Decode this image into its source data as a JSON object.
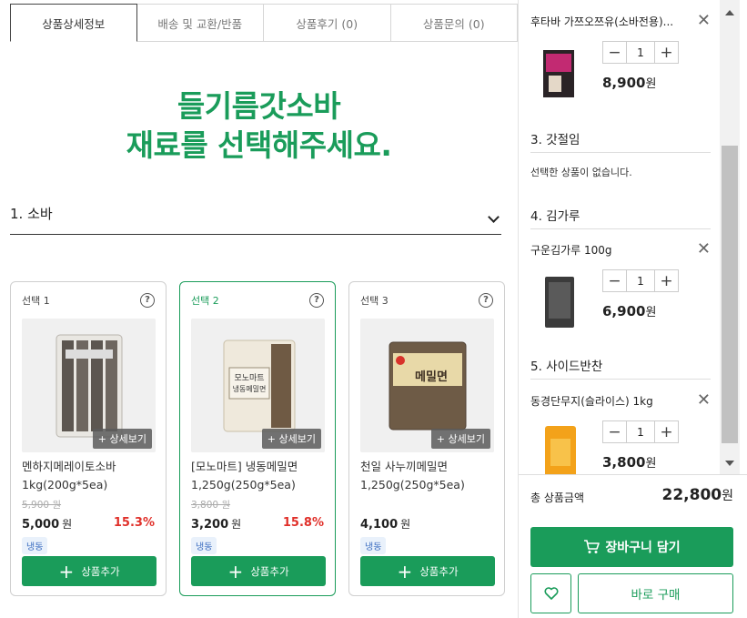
{
  "tabs": [
    {
      "label": "상품상세정보"
    },
    {
      "label": "배송 및 교환/반품"
    },
    {
      "label": "상품후기 (0)"
    },
    {
      "label": "상품문의 (0)"
    }
  ],
  "headline": {
    "line1": "들기름갓소바",
    "line2": "재료를 선택해주세요."
  },
  "section": {
    "label": "1. 소바"
  },
  "products": [
    {
      "option": "선택 1",
      "detail": "+ 상세보기",
      "name": "멘하지메레이토소바 1kg(200g*5ea)",
      "orig_price": "5,900 원",
      "price": "5,000",
      "won": "원",
      "discount": "15.3%",
      "tag": "냉동",
      "add": "상품추가"
    },
    {
      "option": "선택 2",
      "detail": "+ 상세보기",
      "name": "[모노마트] 냉동메밀면 1,250g(250g*5ea)",
      "orig_price": "3,800 원",
      "price": "3,200",
      "won": "원",
      "discount": "15.8%",
      "tag": "냉동",
      "add": "상품추가"
    },
    {
      "option": "선택 3",
      "detail": "+ 상세보기",
      "name": "천일 사누끼메밀면 1,250g(250g*5ea)",
      "orig_price": "",
      "price": "4,100",
      "won": "원",
      "discount": "",
      "tag": "냉동",
      "add": "상품추가"
    }
  ],
  "sidebar": {
    "items": [
      {
        "name": "후타바 가쯔오쯔유(소바전용)...",
        "qty": "1",
        "price": "8,900",
        "won": "원"
      },
      {
        "name": "구운김가루 100g",
        "qty": "1",
        "price": "6,900",
        "won": "원"
      },
      {
        "name": "동경단무지(슬라이스) 1kg",
        "qty": "1",
        "price": "3,800",
        "won": "원"
      }
    ],
    "categories": [
      "3. 갓절임",
      "4. 김가루",
      "5. 사이드반찬"
    ],
    "empty_text": "선택한 상품이 없습니다.",
    "total_label": "총 상품금액",
    "total_amount": "22,800",
    "total_won": "원",
    "cart_label": "장바구니 담기",
    "buy_label": "바로 구매",
    "x_glyph": "✕",
    "minus_glyph": "−",
    "plus_glyph": "+"
  },
  "colors": {
    "accent": "#1a9c5a",
    "discount": "#e0302a",
    "tag_bg": "#e9f1fb"
  }
}
